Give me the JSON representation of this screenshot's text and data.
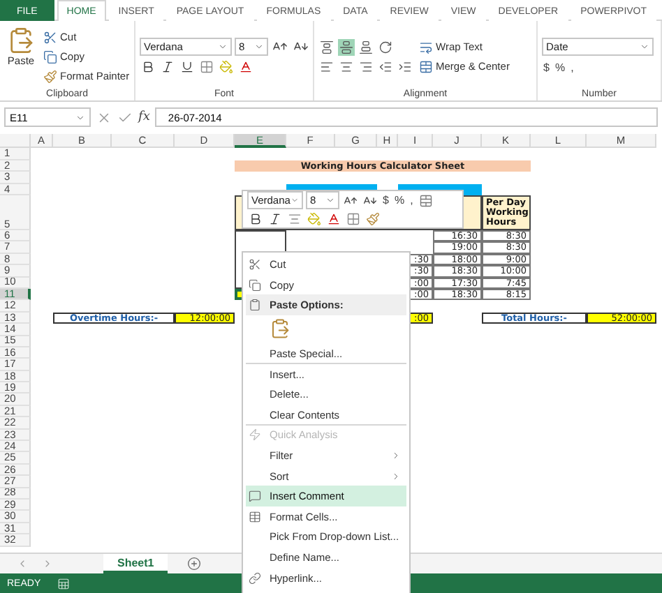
{
  "ribbon": {
    "tabs": [
      {
        "label": "FILE",
        "kind": "file",
        "selected": false
      },
      {
        "label": "HOME",
        "kind": "tab",
        "selected": true
      },
      {
        "label": "INSERT",
        "kind": "tab",
        "selected": false
      },
      {
        "label": "PAGE LAYOUT",
        "kind": "tab",
        "selected": false
      },
      {
        "label": "FORMULAS",
        "kind": "tab",
        "selected": false
      },
      {
        "label": "DATA",
        "kind": "tab",
        "selected": false
      },
      {
        "label": "REVIEW",
        "kind": "tab",
        "selected": false
      },
      {
        "label": "VIEW",
        "kind": "tab",
        "selected": false
      },
      {
        "label": "DEVELOPER",
        "kind": "tab",
        "selected": false
      },
      {
        "label": "POWERPIVOT",
        "kind": "tab",
        "selected": false
      }
    ],
    "clipboard": {
      "paste": "Paste",
      "cut": "Cut",
      "copy": "Copy",
      "painter": "Format Painter",
      "label": "Clipboard"
    },
    "font": {
      "name": "Verdana",
      "size": "8",
      "label": "Font"
    },
    "alignment": {
      "wrap": "Wrap Text",
      "merge": "Merge & Center",
      "label": "Alignment"
    },
    "number": {
      "format": "Date",
      "symbols": [
        "$",
        "%",
        ","
      ],
      "label": "Number"
    }
  },
  "formula_bar": {
    "name_box": "E11",
    "fx": "fx",
    "value": "26-07-2014"
  },
  "sheet": {
    "columns": [
      {
        "label": "A",
        "selected": false
      },
      {
        "label": "B",
        "selected": false
      },
      {
        "label": "C",
        "selected": false
      },
      {
        "label": "D",
        "selected": false
      },
      {
        "label": "E",
        "selected": true
      },
      {
        "label": "F",
        "selected": false
      },
      {
        "label": "G",
        "selected": false
      },
      {
        "label": "H",
        "selected": false
      },
      {
        "label": "I",
        "selected": false
      },
      {
        "label": "J",
        "selected": false
      },
      {
        "label": "K",
        "selected": false
      },
      {
        "label": "L",
        "selected": false
      },
      {
        "label": "M",
        "selected": false
      }
    ],
    "rows": [
      {
        "label": "1",
        "selected": false
      },
      {
        "label": "2",
        "selected": false
      },
      {
        "label": "3",
        "selected": false
      },
      {
        "label": "4",
        "selected": false
      },
      {
        "label": "5",
        "selected": false
      },
      {
        "label": "6",
        "selected": false
      },
      {
        "label": "7",
        "selected": false
      },
      {
        "label": "8",
        "selected": false
      },
      {
        "label": "9",
        "selected": false
      },
      {
        "label": "10",
        "selected": false
      },
      {
        "label": "11",
        "selected": true
      },
      {
        "label": "12",
        "selected": false
      },
      {
        "label": "13",
        "selected": false
      },
      {
        "label": "14",
        "selected": false
      },
      {
        "label": "15",
        "selected": false
      },
      {
        "label": "16",
        "selected": false
      },
      {
        "label": "17",
        "selected": false
      },
      {
        "label": "18",
        "selected": false
      },
      {
        "label": "19",
        "selected": false
      },
      {
        "label": "20",
        "selected": false
      },
      {
        "label": "21",
        "selected": false
      },
      {
        "label": "22",
        "selected": false
      },
      {
        "label": "23",
        "selected": false
      },
      {
        "label": "24",
        "selected": false
      },
      {
        "label": "25",
        "selected": false
      },
      {
        "label": "26",
        "selected": false
      },
      {
        "label": "27",
        "selected": false
      },
      {
        "label": "28",
        "selected": false
      },
      {
        "label": "29",
        "selected": false
      },
      {
        "label": "30",
        "selected": false
      },
      {
        "label": "31",
        "selected": false
      },
      {
        "label": "32",
        "selected": false
      }
    ],
    "cells": [
      {
        "text": "Working Hours Calculator Sheet",
        "kind": "title"
      },
      {
        "text": "Per Day Working Hours",
        "kind": "header"
      },
      {
        "text": "16:30",
        "kind": "time"
      },
      {
        "text": "19:00",
        "kind": "time"
      },
      {
        "text": "18:00",
        "kind": "time"
      },
      {
        "text": "18:30",
        "kind": "time"
      },
      {
        "text": "17:30",
        "kind": "time"
      },
      {
        "text": "18:30",
        "kind": "time"
      },
      {
        "text": "8:30",
        "kind": "time"
      },
      {
        "text": "8:30",
        "kind": "time"
      },
      {
        "text": "9:00",
        "kind": "time"
      },
      {
        "text": "10:00",
        "kind": "time"
      },
      {
        "text": "7:45",
        "kind": "time"
      },
      {
        "text": "8:15",
        "kind": "time"
      },
      {
        "text": ":30",
        "kind": "time"
      },
      {
        "text": ":30",
        "kind": "time"
      },
      {
        "text": ":00",
        "kind": "time"
      },
      {
        "text": ":00",
        "kind": "time"
      },
      {
        "text": "Overtime Hours:-",
        "kind": "label"
      },
      {
        "text": "12:00:00",
        "kind": "total"
      },
      {
        "text": ":00",
        "kind": "total"
      },
      {
        "text": "Total Hours:-",
        "kind": "label"
      },
      {
        "text": "52:00:00",
        "kind": "total"
      }
    ]
  },
  "mini_toolbar": {
    "font": "Verdana",
    "size": "8",
    "symbols": [
      "$",
      "%",
      ","
    ]
  },
  "context_menu": [
    {
      "label": "Cut",
      "kind": "command",
      "selected": false,
      "disabled": false,
      "submenu": false,
      "divider_before": false
    },
    {
      "label": "Copy",
      "kind": "command",
      "selected": false,
      "disabled": false,
      "submenu": false,
      "divider_before": false
    },
    {
      "label": "Paste Options:",
      "kind": "header",
      "selected": false,
      "disabled": false,
      "submenu": false,
      "divider_before": false
    },
    {
      "kind": "paste-icons"
    },
    {
      "label": "Paste Special...",
      "kind": "command",
      "selected": false,
      "disabled": false,
      "submenu": false,
      "divider_before": false
    },
    {
      "label": "Insert...",
      "kind": "command",
      "selected": false,
      "disabled": false,
      "submenu": false,
      "divider_before": true
    },
    {
      "label": "Delete...",
      "kind": "command",
      "selected": false,
      "disabled": false,
      "submenu": false,
      "divider_before": false
    },
    {
      "label": "Clear Contents",
      "kind": "command",
      "selected": false,
      "disabled": false,
      "submenu": false,
      "divider_before": false
    },
    {
      "label": "Quick Analysis",
      "kind": "command",
      "selected": false,
      "disabled": true,
      "submenu": false,
      "divider_before": true
    },
    {
      "label": "Filter",
      "kind": "command",
      "selected": false,
      "disabled": false,
      "submenu": true,
      "divider_before": false
    },
    {
      "label": "Sort",
      "kind": "command",
      "selected": false,
      "disabled": false,
      "submenu": true,
      "divider_before": false
    },
    {
      "label": "Insert Comment",
      "kind": "command",
      "selected": true,
      "disabled": false,
      "submenu": false,
      "divider_before": false
    },
    {
      "label": "Format Cells...",
      "kind": "command",
      "selected": false,
      "disabled": false,
      "submenu": false,
      "divider_before": false
    },
    {
      "label": "Pick From Drop-down List...",
      "kind": "command",
      "selected": false,
      "disabled": false,
      "submenu": false,
      "divider_before": false
    },
    {
      "label": "Define Name...",
      "kind": "command",
      "selected": false,
      "disabled": false,
      "submenu": false,
      "divider_before": false
    },
    {
      "label": "Hyperlink...",
      "kind": "command",
      "selected": false,
      "disabled": false,
      "submenu": false,
      "divider_before": false
    }
  ],
  "sheet_tabs": [
    {
      "label": "Sheet1",
      "selected": true
    }
  ],
  "status_bar": {
    "mode": "READY"
  }
}
